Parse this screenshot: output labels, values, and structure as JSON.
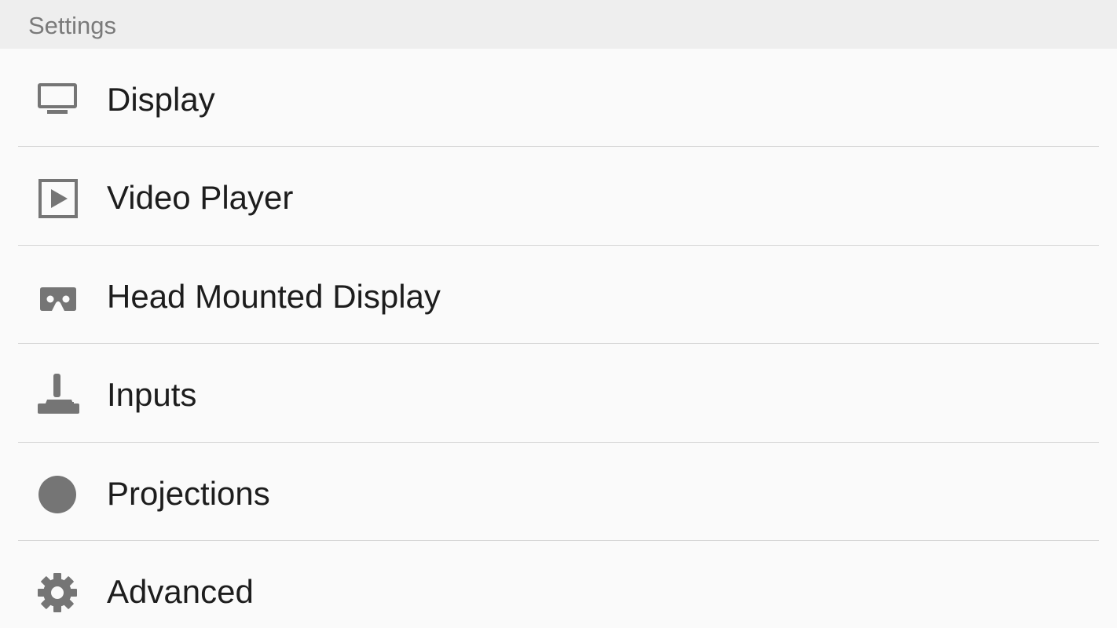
{
  "header": {
    "title": "Settings"
  },
  "items": [
    {
      "label": "Display",
      "icon": "monitor-icon"
    },
    {
      "label": "Video Player",
      "icon": "play-box-icon"
    },
    {
      "label": "Head Mounted Display",
      "icon": "vr-headset-icon"
    },
    {
      "label": "Inputs",
      "icon": "joystick-icon"
    },
    {
      "label": "Projections",
      "icon": "sphere-icon"
    },
    {
      "label": "Advanced",
      "icon": "gear-icon"
    }
  ],
  "colors": {
    "header_bg": "#eeeeee",
    "list_bg": "#fafafa",
    "icon": "#757575",
    "label": "#1d1d1d",
    "header_text": "#7a7a7a",
    "divider": "#d6d6d6"
  }
}
